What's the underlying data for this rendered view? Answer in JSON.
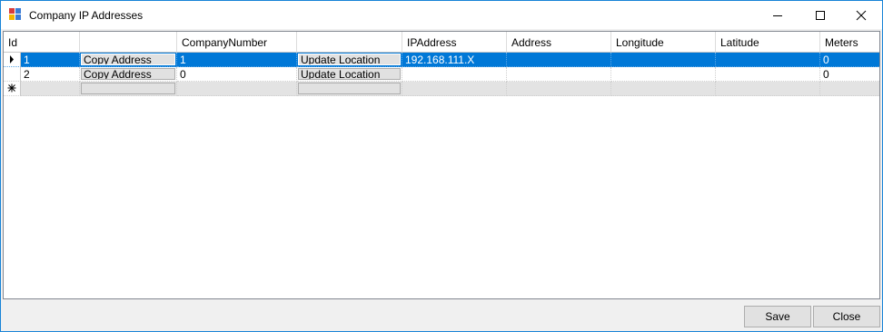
{
  "window": {
    "title": "Company IP Addresses",
    "icon": "app-form-icon",
    "controls": {
      "minimize": "minimize-icon",
      "maximize": "maximize-icon",
      "close": "close-icon"
    }
  },
  "grid": {
    "columns": [
      "Id",
      "",
      "CompanyNumber",
      "",
      "IPAddress",
      "Address",
      "Longitude",
      "Latitude",
      "Meters"
    ],
    "rows": [
      {
        "id": "1",
        "copy_label": "Copy Address",
        "company_number": "1",
        "update_label": "Update Location",
        "ip_address": "192.168.111.X",
        "address": "",
        "longitude": "",
        "latitude": "",
        "meters": "0",
        "selected": true
      },
      {
        "id": "2",
        "copy_label": "Copy Address",
        "company_number": "0",
        "update_label": "Update Location",
        "ip_address": "",
        "address": "",
        "longitude": "",
        "latitude": "",
        "meters": "0",
        "selected": false
      }
    ],
    "selection_color": "#0078d7",
    "current_row_glyph": "row-pointer-icon",
    "new_row_glyph": "new-row-asterisk-icon"
  },
  "footer": {
    "save_label": "Save",
    "close_label": "Close"
  }
}
